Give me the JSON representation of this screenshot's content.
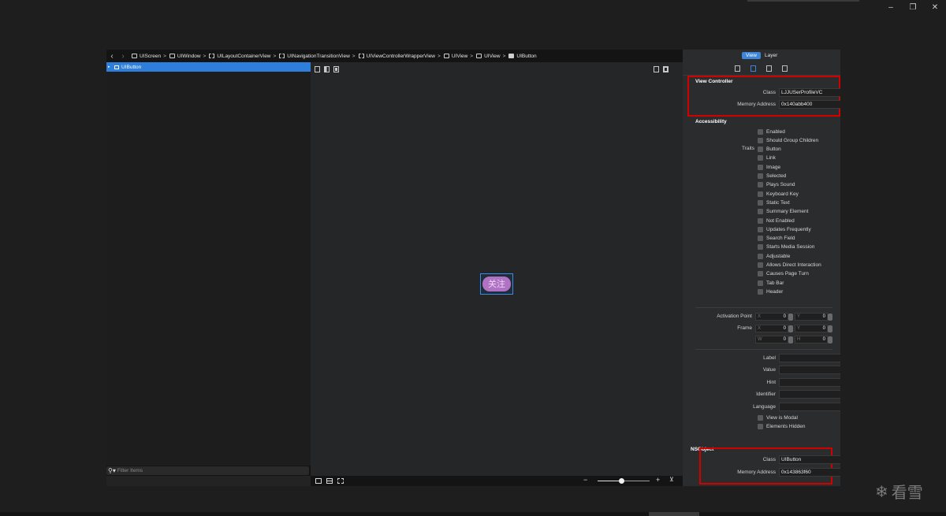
{
  "window": {
    "minimize": "–",
    "restore": "❐",
    "close": "✕"
  },
  "breadcrumb": {
    "items": [
      {
        "label": "UIScreen"
      },
      {
        "label": "UIWindow"
      },
      {
        "label": "UILayoutContainerView"
      },
      {
        "label": "UINavigationTransitionView"
      },
      {
        "label": "UIViewControllerWrapperView"
      },
      {
        "label": "UIView"
      },
      {
        "label": "UIView"
      },
      {
        "label": "UIButton"
      }
    ]
  },
  "tree": {
    "selected_label": "UIButton",
    "filter_placeholder": "Filter Items"
  },
  "canvas": {
    "button_text": "关注"
  },
  "zoom": {
    "level": 0.45
  },
  "inspector": {
    "segments": [
      "View",
      "Layer"
    ],
    "view_controller": {
      "title": "View Controller",
      "class_label": "Class",
      "class_value": "LJJUSerProfileVC",
      "memory_label": "Memory Address",
      "memory_value": "0x140abb400"
    },
    "accessibility": {
      "title": "Accessibility",
      "traits_label": "Traits",
      "options": [
        "Enabled",
        "Should Group Children",
        "Button",
        "Link",
        "Image",
        "Selected",
        "Plays Sound",
        "Keyboard Key",
        "Static Text",
        "Summary Element",
        "Not Enabled",
        "Updates Frequently",
        "Search Field",
        "Starts Media Session",
        "Adjustable",
        "Allows Direct Interaction",
        "Causes Page Turn",
        "Tab Bar",
        "Header"
      ]
    },
    "geometry": {
      "activation_label": "Activation Point",
      "frame_label": "Frame",
      "x": "X",
      "y": "Y",
      "w": "W",
      "h": "H",
      "activation_x": "0",
      "activation_y": "0",
      "frame_x": "0",
      "frame_y": "0",
      "frame_w": "0",
      "frame_h": "0"
    },
    "text_fields": {
      "label": "Label",
      "value": "Value",
      "hint": "Hint",
      "identifier": "Identifier",
      "language": "Language",
      "view_is_modal": "View is Modal",
      "elements_hidden": "Elements Hidden"
    },
    "nsobject": {
      "title": "NSObject",
      "class_label": "Class",
      "class_value": "UIButton",
      "memory_label": "Memory Address",
      "memory_value": "0x143863f60"
    }
  },
  "watermark": {
    "text": "看雪"
  }
}
